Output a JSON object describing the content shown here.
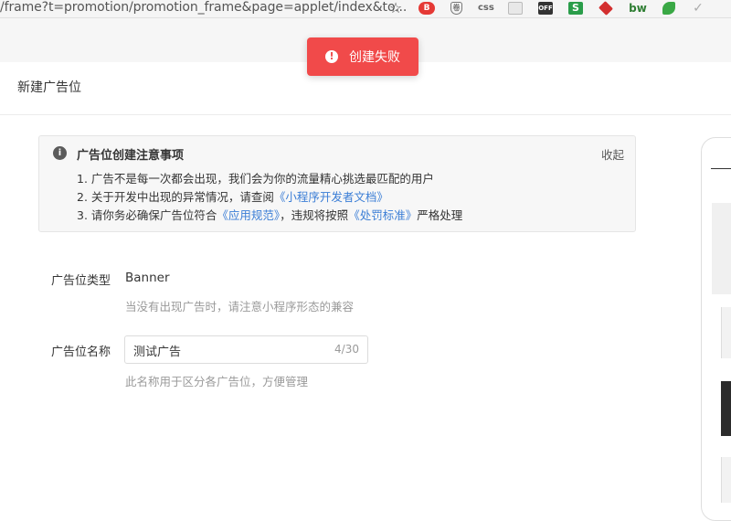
{
  "browser": {
    "url": "/frame?t=promotion/promotion_frame&page=applet/index&to...",
    "extensions": [
      {
        "name": "bookmark-star-icon",
        "glyph": "☆"
      },
      {
        "name": "extension-red-icon",
        "glyph": "B"
      },
      {
        "name": "extension-shield-icon",
        "glyph": "卷"
      },
      {
        "name": "extension-css-icon",
        "glyph": "css"
      },
      {
        "name": "extension-envelope-icon",
        "glyph": ""
      },
      {
        "name": "extension-off-icon",
        "glyph": "OFF"
      },
      {
        "name": "extension-s-icon",
        "glyph": "S"
      },
      {
        "name": "extension-red-diamond-icon",
        "glyph": ""
      },
      {
        "name": "extension-bw-icon",
        "glyph": "bw"
      },
      {
        "name": "extension-evernote-icon",
        "glyph": ""
      },
      {
        "name": "extension-check-icon",
        "glyph": "✓"
      }
    ]
  },
  "toast": {
    "icon": "!",
    "message": "创建失败",
    "color": "#f14a4a"
  },
  "header": {
    "title": "新建广告位"
  },
  "notice": {
    "icon": "i",
    "title": "广告位创建注意事项",
    "collapse_label": "收起",
    "items": [
      {
        "text": "1. 广告不是每一次都会出现，我们会为你的流量精心挑选最匹配的用户"
      },
      {
        "prefix": "2. 关于开发中出现的异常情况，请查阅",
        "link": "《小程序开发者文档》"
      },
      {
        "prefix": "3. 请你务必确保广告位符合",
        "link": "《应用规范》",
        "middle": "，违规将按照",
        "link2": "《处罚标准》",
        "suffix": "严格处理"
      }
    ],
    "link_color": "#3b7ed6"
  },
  "form": {
    "type": {
      "label": "广告位类型",
      "value": "Banner",
      "hint": "当没有出现广告时，请注意小程序形态的兼容"
    },
    "name": {
      "label": "广告位名称",
      "value": "测试广告",
      "count": "4/30",
      "hint": "此名称用于区分各广告位，方便管理"
    }
  }
}
